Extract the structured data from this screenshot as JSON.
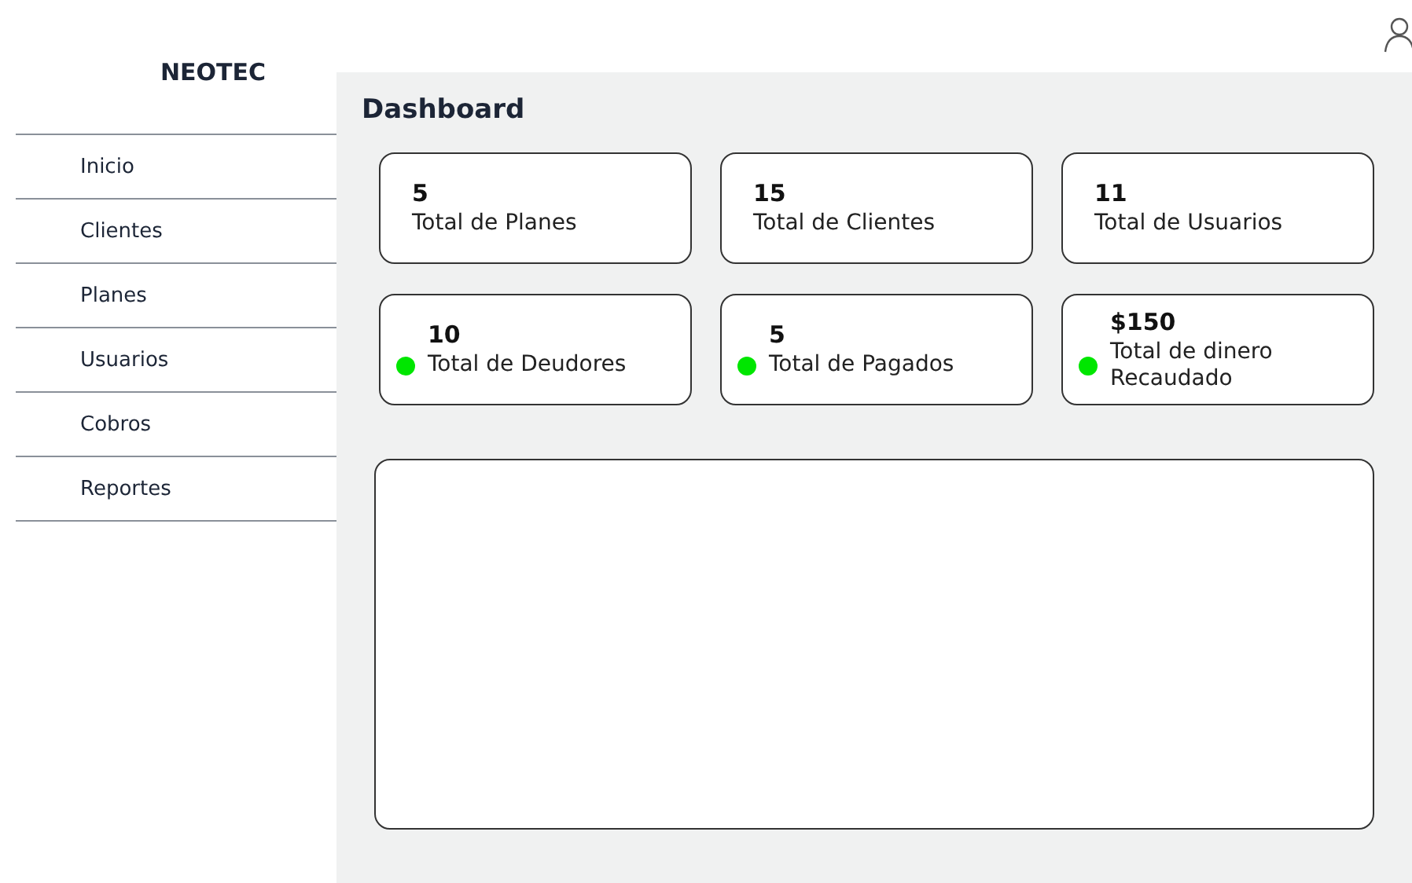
{
  "brand": "NEOTEC",
  "sidebar": {
    "items": [
      {
        "label": "Inicio"
      },
      {
        "label": "Clientes"
      },
      {
        "label": "Planes"
      },
      {
        "label": "Usuarios"
      },
      {
        "label": "Cobros"
      },
      {
        "label": "Reportes"
      }
    ]
  },
  "page_title": "Dashboard",
  "stats": [
    {
      "value": "5",
      "label": "Total de Planes"
    },
    {
      "value": "15",
      "label": "Total de Clientes"
    },
    {
      "value": "11",
      "label": "Total de Usuarios"
    },
    {
      "value": "10",
      "label": "Total de Deudores",
      "color": "#00e600"
    },
    {
      "value": "5",
      "label": "Total de Pagados",
      "color": "#00e600"
    },
    {
      "value": "$150",
      "label": "Total de dinero Recaudado",
      "color": "#00e600"
    }
  ]
}
